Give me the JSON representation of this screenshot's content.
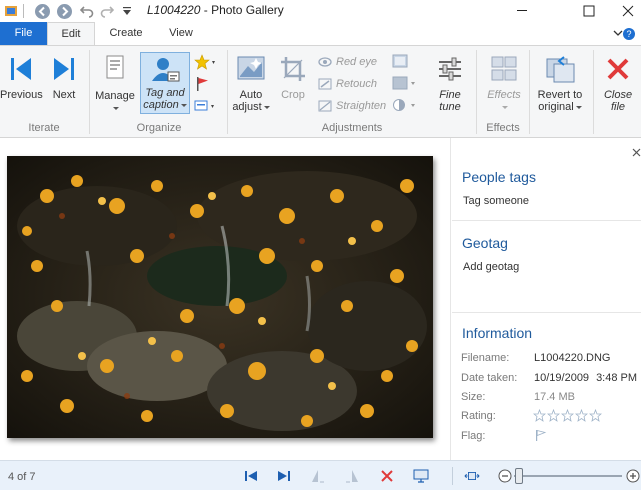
{
  "window": {
    "title_doc": "L1004220",
    "title_app": "Photo Gallery",
    "title_sep": " - "
  },
  "tabs": [
    {
      "label": "File"
    },
    {
      "label": "Edit"
    },
    {
      "label": "Create"
    },
    {
      "label": "View"
    }
  ],
  "ribbon": {
    "iterate": {
      "label": "Iterate",
      "previous": "Previous",
      "next": "Next"
    },
    "organize": {
      "label": "Organize",
      "manage": "Manage",
      "tag_line1": "Tag and",
      "tag_line2": "caption"
    },
    "adjustments": {
      "label": "Adjustments",
      "auto_line1": "Auto",
      "auto_line2": "adjust",
      "crop": "Crop",
      "red_eye": "Red eye",
      "retouch": "Retouch",
      "straighten": "Straighten",
      "fine_line1": "Fine",
      "fine_line2": "tune"
    },
    "effects": {
      "label": "Effects",
      "effects_btn": "Effects"
    },
    "revert": {
      "line1": "Revert to",
      "line2": "original"
    },
    "close": {
      "line1": "Close",
      "line2": "file"
    }
  },
  "pane": {
    "people_title": "People tags",
    "people_action": "Tag someone",
    "geotag_title": "Geotag",
    "geotag_action": "Add geotag",
    "info_title": "Information",
    "info": {
      "filename_label": "Filename:",
      "filename": "L1004220.DNG",
      "date_label": "Date taken:",
      "date": "10/19/2009",
      "time": "3:48 PM",
      "size_label": "Size:",
      "size": "17.4 MB",
      "rating_label": "Rating:",
      "rating": 0,
      "flag_label": "Flag:"
    }
  },
  "status": {
    "position": "4 of 7",
    "zoom": 0.05
  },
  "colors": {
    "file_tab": "#1e6fd1",
    "accent": "#1f5a9c",
    "delete": "#e03a3a"
  }
}
